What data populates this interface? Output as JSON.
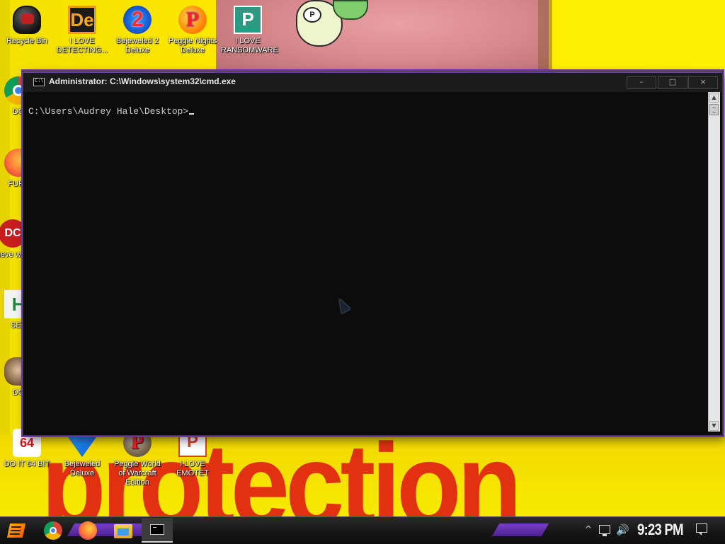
{
  "wallpaper": {
    "word": "protection",
    "colors": {
      "yellow": "#f3e100",
      "red": "#e02812",
      "pink": "#d98a8e"
    }
  },
  "desktop_icons": {
    "top": [
      {
        "label": "Recycle Bin",
        "icon": "recycle-bin-icon"
      },
      {
        "label": "I LOVE DETECTING...",
        "icon": "de-logo-icon"
      },
      {
        "label": "Bejeweled 2 Deluxe",
        "icon": "bejeweled-2-icon"
      },
      {
        "label": "Peggle Nights Deluxe",
        "icon": "peggle-icon"
      },
      {
        "label": "I LOVE RANSOMWARE",
        "icon": "publisher-icon"
      }
    ],
    "left": [
      {
        "label": "DO",
        "icon": "chrome-icon"
      },
      {
        "label": "FURF",
        "icon": "firefox-icon"
      },
      {
        "label": "neve why",
        "icon": "dc-icon"
      },
      {
        "label": "SEX",
        "icon": "h-icon"
      },
      {
        "label": "DO",
        "icon": "portrait-icon"
      }
    ],
    "bottom": [
      {
        "label": "DO IT 64 BIT",
        "icon": "64bit-icon"
      },
      {
        "label": "Bejeweled Deluxe",
        "icon": "bejeweled-icon"
      },
      {
        "label": "Peggle World of Warcraft Edition",
        "icon": "peggle-wow-icon"
      },
      {
        "label": "I LOVE EMOTET",
        "icon": "powerpoint-icon"
      }
    ]
  },
  "cmd": {
    "title": "Administrator: C:\\Windows\\system32\\cmd.exe",
    "prompt": "C:\\Users\\Audrey Hale\\Desktop>",
    "buttons": {
      "minimize": "–",
      "maximize": "□",
      "close": "×"
    },
    "scroll_up": "▲",
    "scroll_down": "▼"
  },
  "taskbar": {
    "pinned": [
      "chrome-icon",
      "firefox-icon",
      "file-explorer-icon",
      "cmd-icon"
    ],
    "tray_chevron": "^",
    "volume_glyph": "🔊",
    "clock": "9:23 PM"
  }
}
